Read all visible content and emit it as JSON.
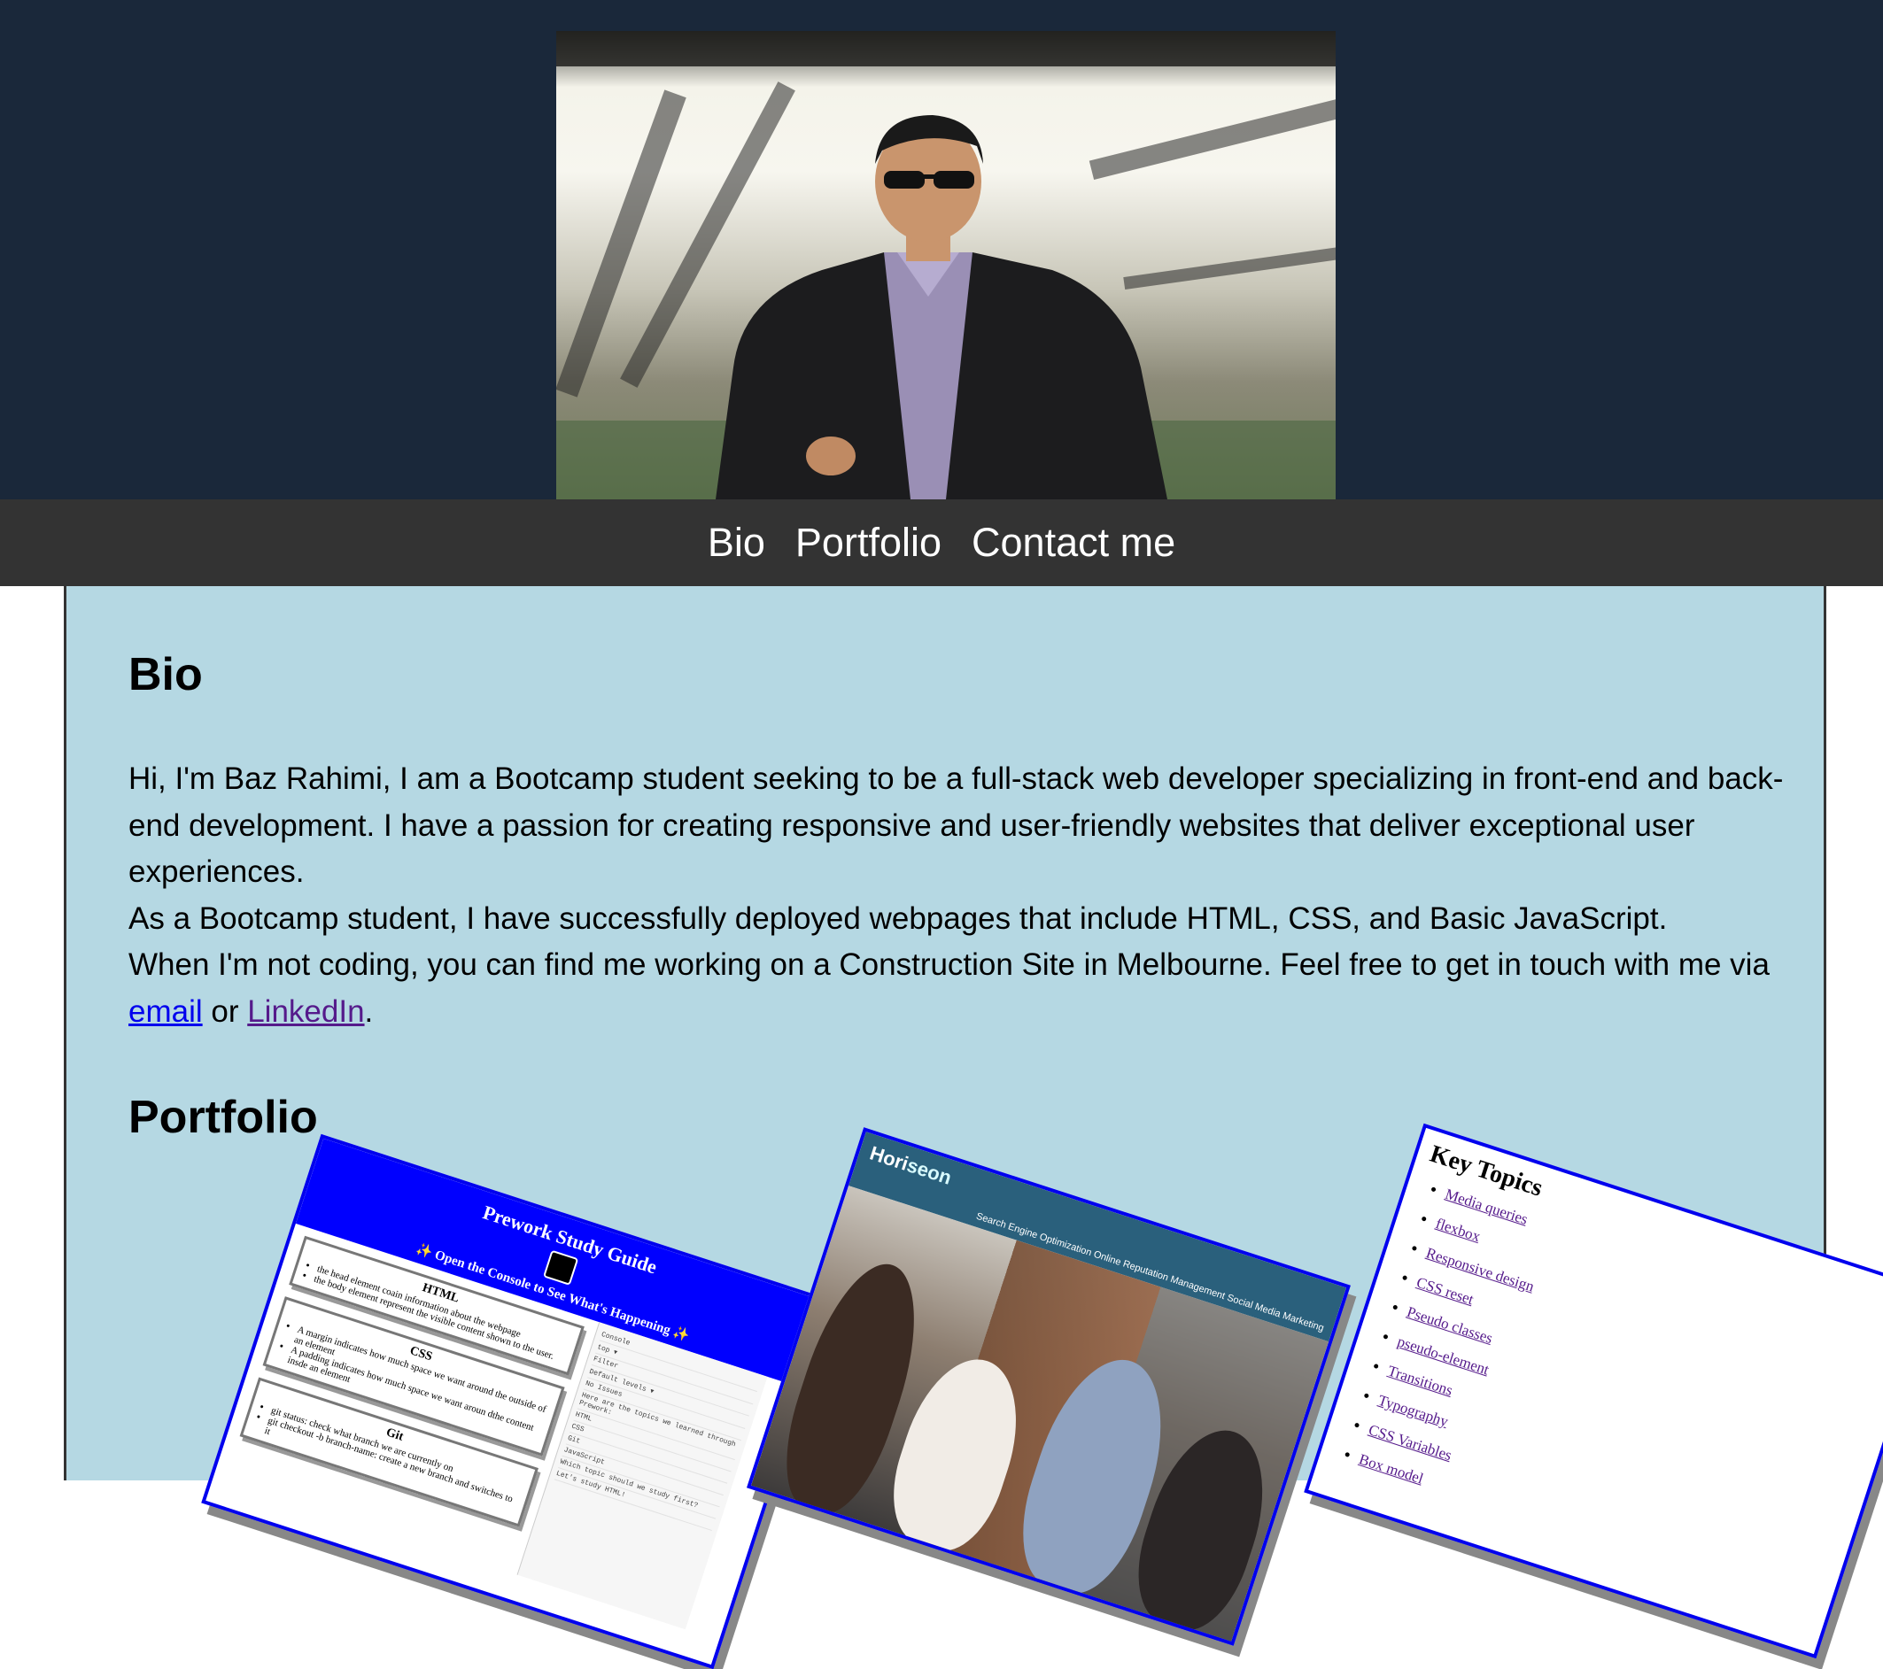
{
  "nav": {
    "items": [
      {
        "label": "Bio"
      },
      {
        "label": "Portfolio"
      },
      {
        "label": "Contact me"
      }
    ]
  },
  "bio": {
    "title": "Bio",
    "line1": "Hi, I'm Baz Rahimi, I am a Bootcamp student seeking to be a full-stack web developer specializing in front-end and back-end development. I have a passion for creating responsive and user-friendly websites that deliver exceptional user experiences.",
    "line2": "As a Bootcamp student, I have successfully deployed webpages that include HTML, CSS, and Basic JavaScript.",
    "line3_pre": "When I'm not coding, you can find me working on a Construction Site in Melbourne. Feel free to get in touch with me via ",
    "email_link": "email",
    "line3_mid": " or ",
    "linkedin_link": "LinkedIn",
    "line3_post": "."
  },
  "portfolio": {
    "title": "Portfolio",
    "study_guide": {
      "title": "Prework Study Guide",
      "subtitle": "✨ Open the Console to See What's Happening ✨",
      "sections": [
        {
          "heading": "HTML",
          "items": [
            "the head element coain information about the webpage",
            "the body element represent the visible content shown to the user."
          ]
        },
        {
          "heading": "CSS",
          "items": [
            "A margin indicates how much space we want around the outside of an element",
            "A padding indicates how much space we want aroun dthe content insde an element"
          ]
        },
        {
          "heading": "Git",
          "items": [
            "git status: check what branch we are currently on",
            "git checkout -b branch-name: create a new branch and switches to it"
          ]
        }
      ],
      "console_lines": [
        "Console",
        "top ▾",
        "Filter",
        "Default levels ▾",
        "No Issues",
        "Here are the topics we learned through Prework:",
        "HTML",
        "CSS",
        "Git",
        "JavaScript",
        "Which topic should we study first?",
        "Let's study HTML!"
      ]
    },
    "horiseon": {
      "logo_main": "Hori",
      "logo_accent": "seon",
      "nav": "Search Engine Optimization   Online Reputation Management   Social Media Marketing"
    },
    "key_topics": {
      "title": "Key Topics",
      "items": [
        "Media queries",
        "flexbox",
        "Responsive design",
        "CSS reset",
        "Pseudo classes",
        "pseudo-element",
        "Transitions",
        "Typography",
        "CSS Variables",
        "Box model"
      ]
    }
  },
  "colors": {
    "hero_bg": "#1a283a",
    "nav_bg": "#333333",
    "main_bg": "#b5d8e3",
    "card_border": "#0000ee"
  }
}
